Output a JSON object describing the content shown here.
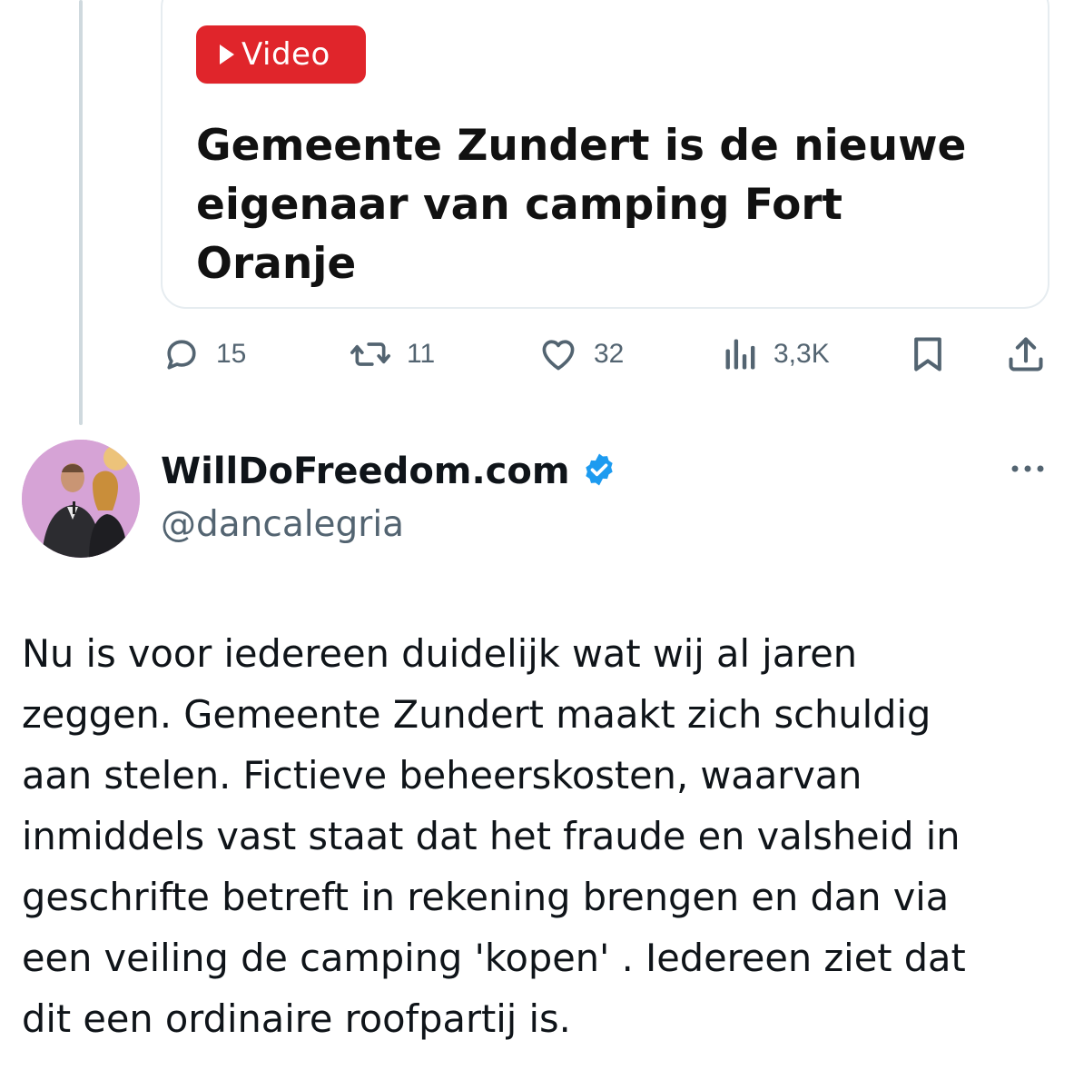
{
  "quoted_card": {
    "badge_label": "Video",
    "headline": "Gemeente Zundert is de nieuwe eigenaar van camping Fort Oranje"
  },
  "actions": {
    "replies": "15",
    "reposts": "11",
    "likes": "32",
    "views": "3,3K"
  },
  "tweet": {
    "display_name": "WillDoFreedom.com",
    "handle": "@dancalegria",
    "verified": true,
    "text": "Nu is voor iedereen duidelijk wat wij al jaren\nzeggen. Gemeente Zundert maakt zich schuldig\naan stelen. Fictieve beheerskosten, waarvan\ninmiddels vast staat dat het fraude en valsheid in\ngeschrifte betreft in rekening brengen en dan via\neen veiling de camping 'kopen' . Iedereen ziet dat\ndit een ordinaire roofpartij is."
  },
  "colors": {
    "badge": "#e0252b",
    "verified": "#1d9bf0",
    "muted": "#536471",
    "text": "#0f1419"
  }
}
